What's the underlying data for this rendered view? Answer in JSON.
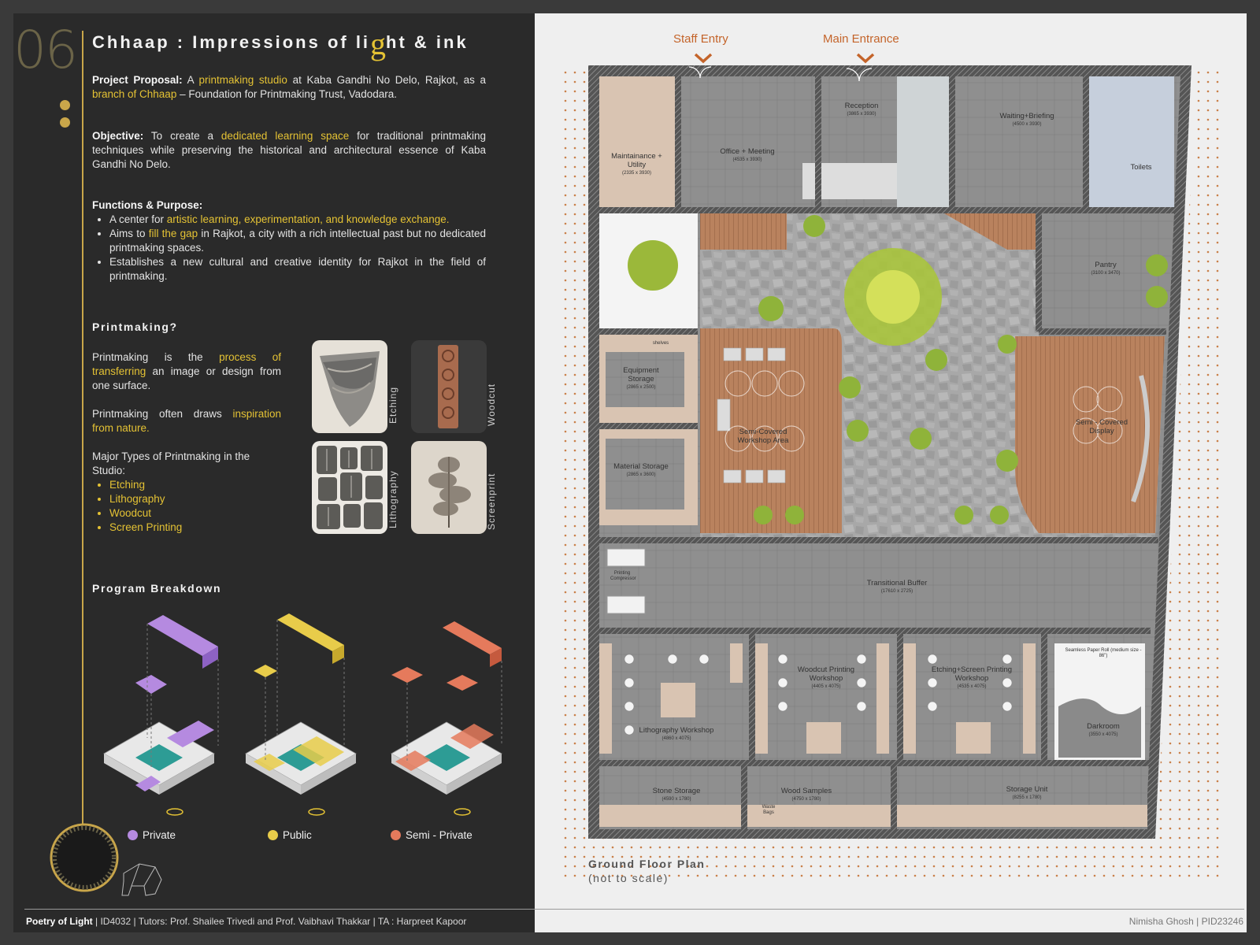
{
  "header": {
    "number": "06",
    "title_pre": "Chhaap : Impressions of li",
    "title_g": "g",
    "title_post": "ht & ink"
  },
  "proposal": {
    "label": "Project Proposal:",
    "t1": " A ",
    "h1": "printmaking studio",
    "t2": " at Kaba Gandhi No Delo, Rajkot, as a ",
    "h2": "branch of Chhaap",
    "t3": " – Foundation for Printmaking Trust, Vadodara."
  },
  "objective": {
    "label": "Objective:",
    "t1": " To create a ",
    "h1": "dedicated learning space",
    "t2": " for traditional printmaking techniques while preserving the historical and architectural essence of Kaba Gandhi No Delo."
  },
  "functions": {
    "label": "Functions & Purpose:",
    "item1_a": "A center for ",
    "item1_h": "artistic learning, experimentation, and knowledge exchange.",
    "item2_a": "Aims to ",
    "item2_h": "fill the gap",
    "item2_b": " in Rajkot, a city with a rich intellectual past but no dedicated printmaking spaces.",
    "item3": "Establishes a new cultural and creative identity for Rajkot in the field of printmaking."
  },
  "printmaking": {
    "heading": "Printmaking?",
    "p1_a": "Printmaking is the ",
    "p1_h": "process of transferring",
    "p1_b": " an image or design from one surface.",
    "p2_a": "Printmaking often draws ",
    "p2_h": "inspiration from nature.",
    "p3": "Major Types of Printmaking in the Studio:",
    "types": [
      "Etching",
      "Lithography",
      "Woodcut",
      "Screen Printing"
    ],
    "photo_labels": [
      "Etching",
      "Woodcut",
      "Lithography",
      "Screenprint"
    ]
  },
  "program": {
    "heading": "Program Breakdown",
    "legend": [
      {
        "label": "Private",
        "color": "#b58ae0"
      },
      {
        "label": "Public",
        "color": "#e8cc4a"
      },
      {
        "label": "Semi - Private",
        "color": "#e57a5c"
      }
    ]
  },
  "plan": {
    "staff_entry": "Staff Entry",
    "main_entrance": "Main Entrance",
    "title": "Ground Floor Plan",
    "subtitle": "(not to scale)",
    "rooms": {
      "maintenance": "Maintainance + Utility",
      "maintenance_dim": "(2335 x 3930)",
      "office": "Office + Meeting",
      "office_dim": "(4535 x 3930)",
      "reception": "Reception",
      "reception_dim": "(3865 x 3930)",
      "waiting": "Waiting+Briefing",
      "waiting_dim": "(4500 x 3930)",
      "toilets": "Toilets",
      "pantry": "Pantry",
      "pantry_dim": "(3100 x 3470)",
      "equipment": "Equipment Storage",
      "equipment_dim": "(2865 x 2500)",
      "material": "Material Storage",
      "material_dim": "(2865 x 3600)",
      "workshop_area": "Semi-Covered Workshop Area",
      "display": "Semi - Covered Display",
      "buffer": "Transitional Buffer",
      "buffer_dim": "(17610 x 2725)",
      "lithography": "Lithography Workshop",
      "lithography_dim": "(4860 x 4075)",
      "woodcut": "Woodcut Printing Workshop",
      "woodcut_dim": "(4405 x 4075)",
      "etching": "Etching+Screen Printing Workshop",
      "etching_dim": "(4535 x 4075)",
      "darkroom": "Darkroom",
      "darkroom_dim": "(3550 x 4075)",
      "paper_roll": "Seamless Paper Roll (medium size - 86\")",
      "stone": "Stone Storage",
      "stone_dim": "(4590 x 1780)",
      "wood": "Wood Samples",
      "wood_dim": "(4750 x 1780)",
      "storage": "Storage Unit",
      "storage_dim": "(8255 x 1780)",
      "shelves": "shelves",
      "waste": "Waste Bags",
      "printing_compressor": "Printing Compressor"
    }
  },
  "footer": {
    "project": "Poetry of Light",
    "rest": " | ID4032 | Tutors: Prof. Shailee Trivedi and Prof. Vaibhavi Thakkar |  TA : Harpreet Kapoor",
    "author": "Nimisha Ghosh | PID23246"
  },
  "colors": {
    "accent": "#e4c234",
    "orange": "#c4642a",
    "background": "#2a2a2a"
  }
}
